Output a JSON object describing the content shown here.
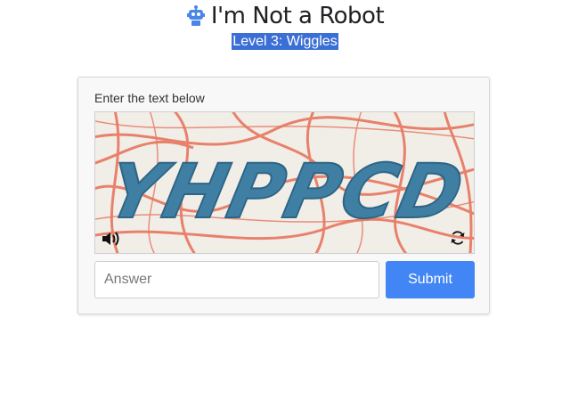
{
  "header": {
    "icon": "robot-icon",
    "title": "I'm Not a Robot",
    "level": "Level 3: Wiggles"
  },
  "captcha": {
    "instruction": "Enter the text below",
    "challenge_text": "YHPPCD",
    "audio_icon": "speaker-icon",
    "refresh_icon": "refresh-icon"
  },
  "form": {
    "answer_placeholder": "Answer",
    "answer_value": "",
    "submit_label": "Submit"
  },
  "colors": {
    "accent": "#4285f4",
    "highlight": "#3b6fd6",
    "captcha_text": "#3f7fa3",
    "captcha_lines": "#e8765e"
  }
}
